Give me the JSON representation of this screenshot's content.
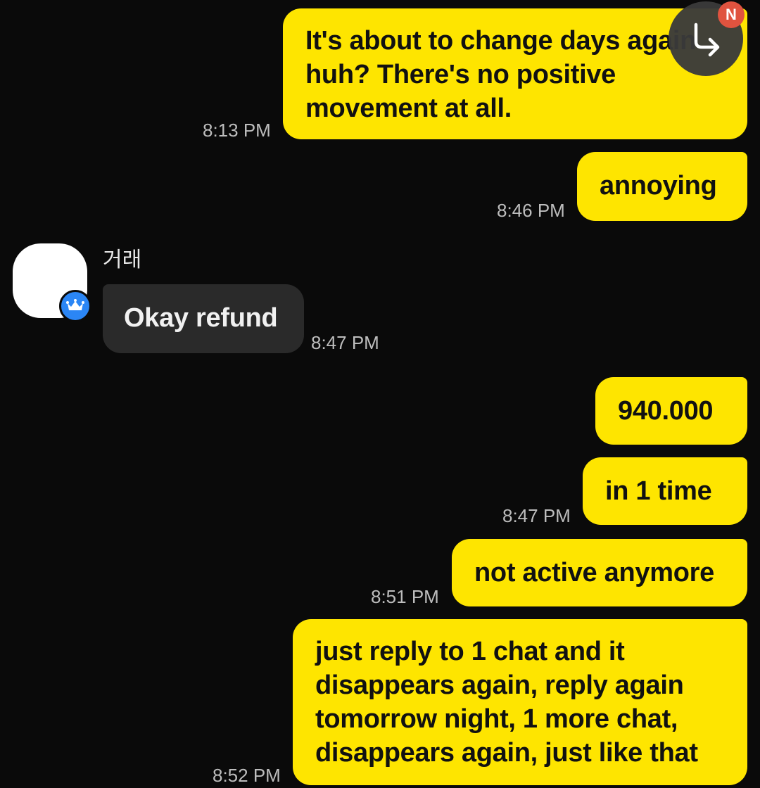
{
  "messages": [
    {
      "sender": "me",
      "text": "It's about to change days again huh? There's no positive movement at all.",
      "time": "8:13 PM"
    },
    {
      "sender": "me",
      "text": "annoying",
      "time": "8:46 PM"
    },
    {
      "sender": "other",
      "name": "거래",
      "text": "Okay refund",
      "time": "8:47 PM"
    },
    {
      "sender": "me",
      "text": "940.000",
      "time": ""
    },
    {
      "sender": "me",
      "text": "in 1 time",
      "time": "8:47 PM"
    },
    {
      "sender": "me",
      "text": "not active anymore",
      "time": "8:51 PM"
    },
    {
      "sender": "me",
      "text": "just reply to 1 chat and it disappears again, reply again tomorrow night, 1 more chat, disappears again, just like that",
      "time": "8:52 PM"
    }
  ],
  "floating_button": {
    "icon": "reply-arrow-icon",
    "badge": "N"
  },
  "avatar_badge_icon": "crown-icon",
  "colors": {
    "background": "#0a0a0a",
    "my_bubble": "#fee500",
    "their_bubble": "#2a2a2a",
    "accent_badge": "#2b86f5",
    "notification": "#e0533f"
  }
}
